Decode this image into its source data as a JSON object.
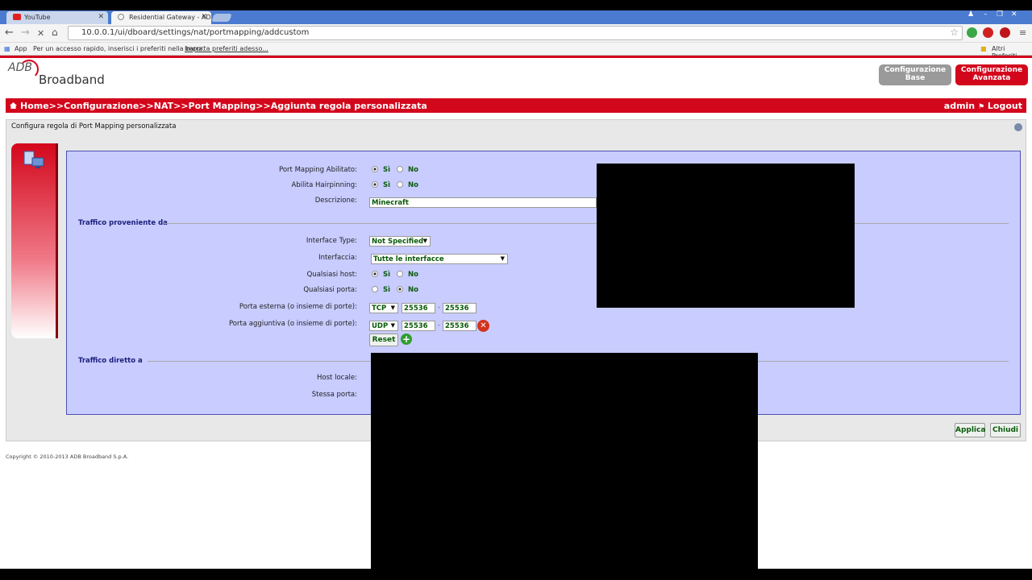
{
  "browser": {
    "tabs": [
      {
        "label": "YouTube",
        "active": false
      },
      {
        "label": "Residential Gateway - ADB",
        "active": true
      }
    ],
    "url": "10.0.0.1/ui/dboard/settings/nat/portmapping/addcustom",
    "bookmarks": {
      "apps_label": "App",
      "hint": "Per un accesso rapido, inserisci i preferiti nella barra.",
      "import_link": "Importa preferiti adesso...",
      "other": "Altri Preferiti"
    }
  },
  "header": {
    "logo_adb": "ADB",
    "logo_broadband": "Broadband",
    "btn_base_line1": "Configurazione",
    "btn_base_line2": "Base",
    "btn_adv_line1": "Configurazione",
    "btn_adv_line2": "Avanzata"
  },
  "breadcrumb": {
    "path": "Home>>Configurazione>>NAT>>Port Mapping>>Aggiunta regola personalizzata",
    "user": "admin",
    "logout": "Logout"
  },
  "panel": {
    "title": "Configura regola di Port Mapping personalizzata"
  },
  "form": {
    "port_mapping_label": "Port Mapping Abilitato:",
    "hairpin_label": "Abilita Hairpinning:",
    "description_label": "Descrizione:",
    "description_value": "Minecraft",
    "section_source": "Traffico proveniente da",
    "interface_type_label": "Interface Type:",
    "interface_type_value": "Not Specified",
    "interfaccia_label": "Interfaccia:",
    "interfaccia_value": "Tutte le interfacce",
    "any_host_label": "Qualsiasi host:",
    "any_port_label": "Qualsiasi porta:",
    "ext_port_label": "Porta esterna (o insieme di porte):",
    "ext_proto": "TCP",
    "ext_from": "25536",
    "ext_to": "25536",
    "add_port_label": "Porta aggiuntiva (o insieme di porte):",
    "add_proto": "UDP",
    "add_from": "25536",
    "add_to": "25536",
    "reset_label": "Reset",
    "section_dest": "Traffico diretto a",
    "local_host_label": "Host locale:",
    "same_port_label": "Stessa porta:",
    "si": "Sì",
    "no": "No"
  },
  "actions": {
    "apply": "Applica",
    "close": "Chiudi"
  },
  "footer": {
    "copyright": "Copyright © 2010-2013 ADB Broadband S.p.A."
  },
  "colors": {
    "brand_red": "#d3071c",
    "form_bg": "#c8ccff",
    "value_green": "#0a5a0a"
  }
}
